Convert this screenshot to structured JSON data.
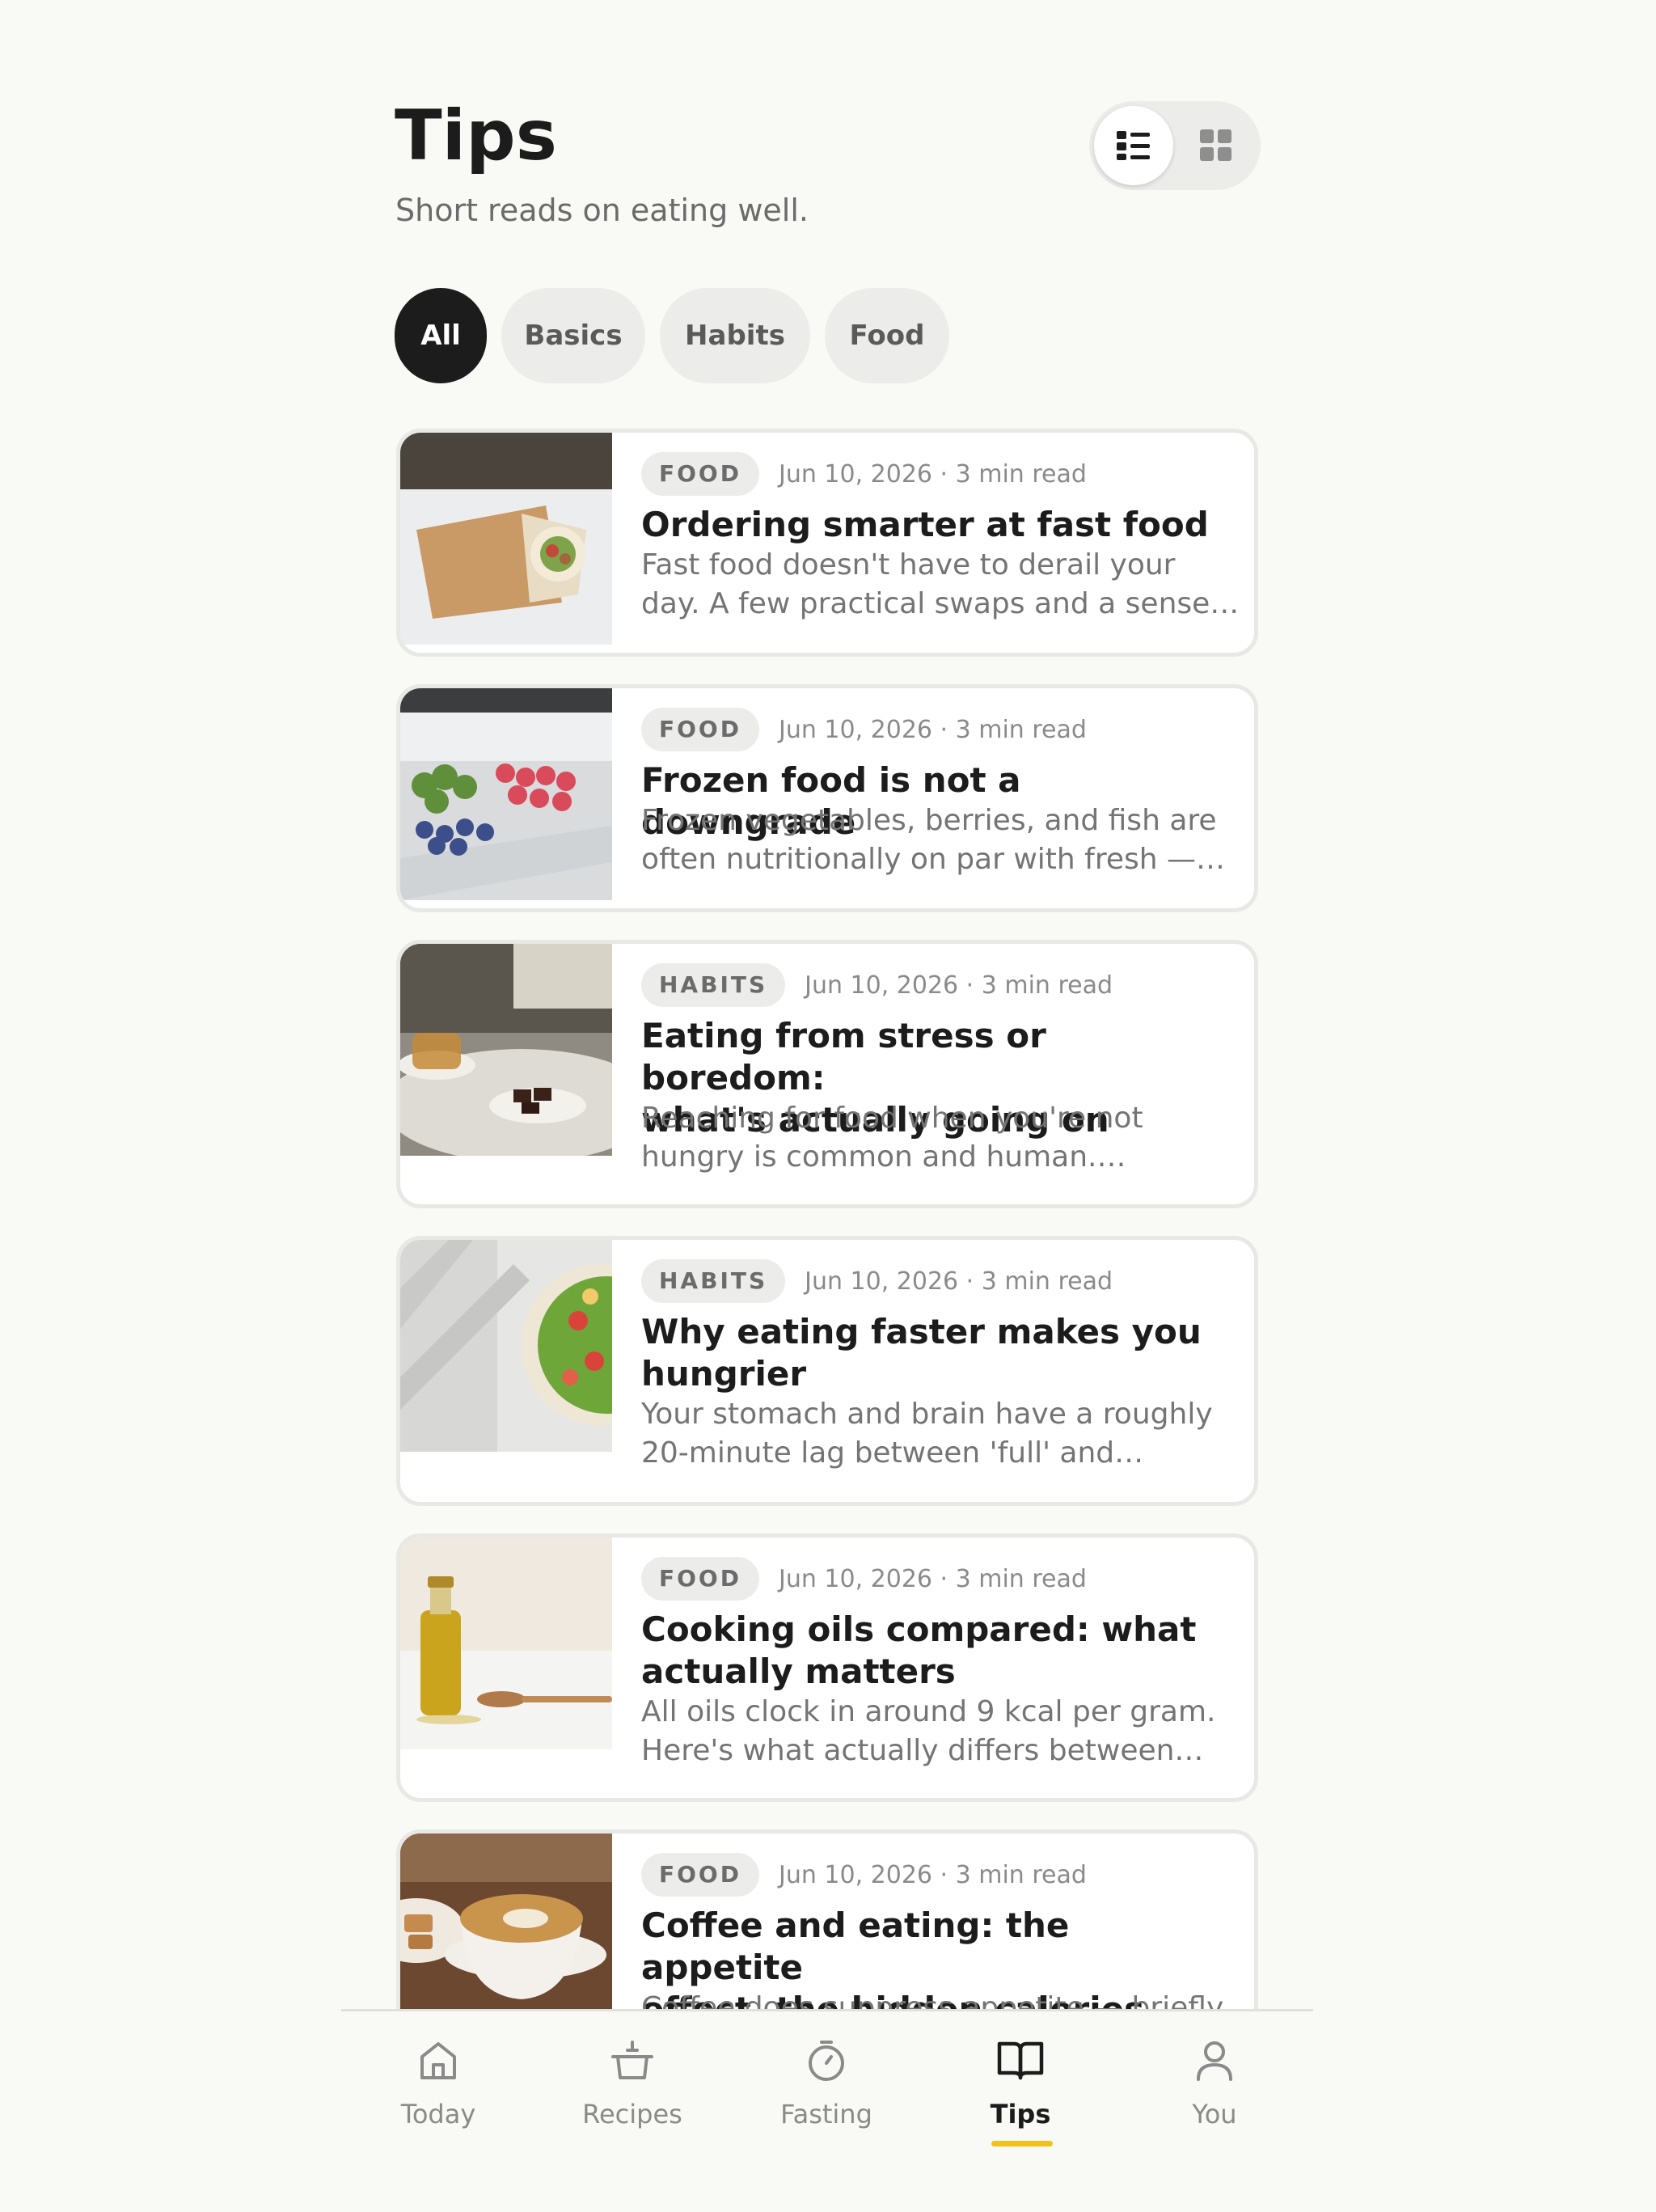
{
  "header": {
    "title": "Tips",
    "subtitle": "Short reads on eating well."
  },
  "view_toggle": {
    "options": [
      "list-view-icon",
      "grid-view-icon"
    ],
    "selected": "list"
  },
  "filters": {
    "selected": "All",
    "chips": [
      "All",
      "Basics",
      "Habits",
      "Food"
    ]
  },
  "articles": [
    {
      "category": "FOOD",
      "date": "Jun 10, 2026 · 3 min read",
      "title": "Ordering smarter at fast food",
      "excerpt_lines": [
        "Fast food doesn't have to derail your",
        "day. A few practical swaps and a sense…"
      ],
      "image": "wrap-image"
    },
    {
      "category": "FOOD",
      "date": "Jun 10, 2026 · 3 min read",
      "title": "Frozen food is not a downgrade",
      "excerpt_lines": [
        "Frozen vegetables, berries, and fish are",
        "often nutritionally on par with fresh —…"
      ],
      "image": "freezer-drawer-image"
    },
    {
      "category": "HABITS",
      "date": "Jun 10, 2026 · 3 min read",
      "title_lines": [
        "Eating from stress or boredom:",
        "what's actually going on"
      ],
      "excerpt_lines": [
        "Reaching for food when you're not",
        "hungry is common and human.…"
      ],
      "image": "tea-chocolate-image"
    },
    {
      "category": "HABITS",
      "date": "Jun 10, 2026 · 3 min read",
      "title_lines": [
        "Why eating faster makes you",
        "hungrier"
      ],
      "excerpt_lines": [
        "Your stomach and brain have a roughly",
        "20-minute lag between 'full' and…"
      ],
      "image": "salad-bowl-image"
    },
    {
      "category": "FOOD",
      "date": "Jun 10, 2026 · 3 min read",
      "title_lines": [
        "Cooking oils compared: what",
        "actually matters"
      ],
      "excerpt_lines": [
        "All oils clock in around 9 kcal per gram.",
        "Here's what actually differs between…"
      ],
      "image": "olive-oil-image"
    },
    {
      "category": "FOOD",
      "date": "Jun 10, 2026 · 3 min read",
      "title_lines": [
        "Coffee and eating: the appetite",
        "effect, the hidden calories, an…"
      ],
      "excerpt_lines": [
        "Coffee does suppress appetite — briefly"
      ],
      "image": "coffee-cup-image"
    }
  ],
  "tabbar": {
    "active": "Tips",
    "tabs": [
      {
        "label": "Today",
        "icon": "home-icon"
      },
      {
        "label": "Recipes",
        "icon": "pot-icon"
      },
      {
        "label": "Fasting",
        "icon": "timer-icon"
      },
      {
        "label": "Tips",
        "icon": "book-icon"
      },
      {
        "label": "You",
        "icon": "person-icon"
      }
    ]
  },
  "colors": {
    "background": "#f9f9f6",
    "accent": "#f2c21b",
    "active_chip": "#1c1c1c",
    "chip": "#ececea"
  }
}
